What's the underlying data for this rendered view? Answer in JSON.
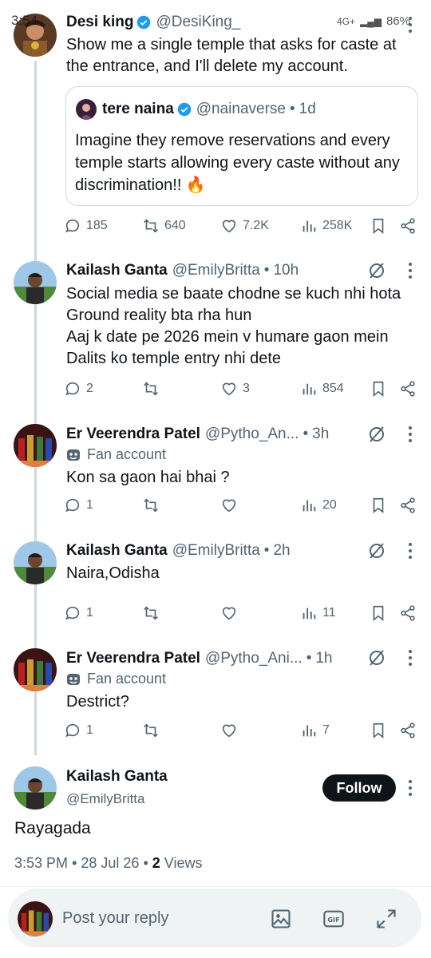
{
  "status_bar": {
    "time": "3:54",
    "network": "4G+",
    "battery": "86%"
  },
  "main_tweet": {
    "author": "Desi king",
    "handle": "@DesiKing_",
    "text": "Show me a single temple that asks for caste at the entrance, and I'll delete my account.",
    "quote": {
      "author": "tere naina",
      "handle": "@nainaverse",
      "time": "1d",
      "text": "Imagine they remove reservations and every temple starts allowing every caste without any discrimination!! 🔥"
    },
    "stats": {
      "replies": "185",
      "reposts": "640",
      "likes": "7.2K",
      "views": "258K"
    }
  },
  "replies": [
    {
      "author": "Kailash Ganta",
      "handle": "@EmilyBritta",
      "time": "10h",
      "badge": "",
      "text_lines": [
        "Social media se baate chodne se kuch nhi hota",
        "Ground reality bta rha hun",
        "Aaj k date pe 2026 mein v humare gaon mein",
        "Dalits ko temple entry nhi dete"
      ],
      "stats": {
        "replies": "2",
        "reposts": "",
        "likes": "3",
        "views": "854"
      }
    },
    {
      "author": "Er Veerendra Patel",
      "handle": "@Pytho_An...",
      "time": "3h",
      "badge": "Fan account",
      "text_lines": [
        "Kon sa gaon hai bhai ?"
      ],
      "stats": {
        "replies": "1",
        "reposts": "",
        "likes": "",
        "views": "20"
      }
    },
    {
      "author": "Kailash Ganta",
      "handle": "@EmilyBritta",
      "time": "2h",
      "badge": "",
      "text_lines": [
        "Naira,Odisha"
      ],
      "stats": {
        "replies": "1",
        "reposts": "",
        "likes": "",
        "views": "11"
      }
    },
    {
      "author": "Er Veerendra Patel",
      "handle": "@Pytho_Ani...",
      "time": "1h",
      "badge": "Fan account",
      "text_lines": [
        "Destrict?"
      ],
      "stats": {
        "replies": "1",
        "reposts": "",
        "likes": "",
        "views": "7"
      }
    }
  ],
  "focused_tweet": {
    "author": "Kailash Ganta",
    "handle": "@EmilyBritta",
    "follow_label": "Follow",
    "text": "Rayagada",
    "time": "3:53 PM",
    "date": "28 Jul 26",
    "views_count": "2",
    "views_label": "Views"
  },
  "reply_bar": {
    "placeholder": "Post your reply"
  },
  "colors": {
    "text": "#0f1419",
    "secondary": "#536471",
    "verified": "#1d9bf0",
    "border": "#cfd9de"
  }
}
